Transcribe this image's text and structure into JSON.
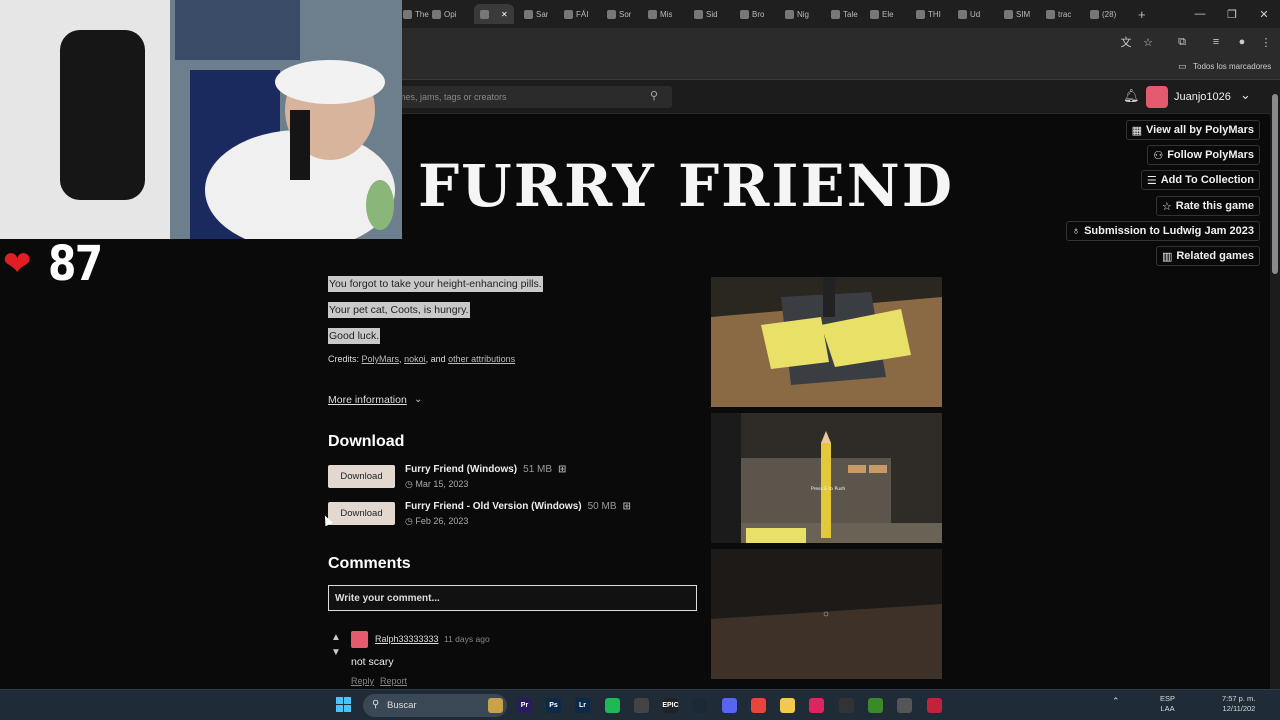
{
  "browser": {
    "tabs": [
      {
        "label": "The"
      },
      {
        "label": "Opi"
      },
      {
        "label": "",
        "active": true
      },
      {
        "label": "Sar"
      },
      {
        "label": "FÁI"
      },
      {
        "label": "Sor"
      },
      {
        "label": "Mis"
      },
      {
        "label": "Sid"
      },
      {
        "label": "Bro"
      },
      {
        "label": "Nig"
      },
      {
        "label": "Tale"
      },
      {
        "label": "Ele"
      },
      {
        "label": "THI"
      },
      {
        "label": "Ud"
      },
      {
        "label": "SIM"
      },
      {
        "label": "trac"
      },
      {
        "label": "(28)"
      }
    ],
    "bookmarks_folder": "Todos los marcadores"
  },
  "itch_header": {
    "search_placeholder": "Search for games, jams, tags or creators",
    "search_visible": "mes, jams, tags or creators",
    "username": "Juanjo1026"
  },
  "game": {
    "title": "FURRY FRIEND",
    "side_buttons": [
      {
        "label": "View all by PolyMars",
        "icon": "itch-icon"
      },
      {
        "label": "Follow PolyMars",
        "icon": "follow-user-icon"
      },
      {
        "label": "Add To Collection",
        "icon": "add-list-icon"
      },
      {
        "label": "Rate this game",
        "icon": "star-icon"
      },
      {
        "label": "Submission to Ludwig Jam 2023",
        "icon": "award-icon"
      },
      {
        "label": "Related games",
        "icon": "map-icon"
      }
    ],
    "description": [
      "You forgot to take your height-enhancing pills.",
      "Your pet cat, Coots, is hungry.",
      "Good luck."
    ],
    "credits_prefix": "Credits:",
    "credits": [
      "PolyMars",
      "nokoi",
      "other attributions"
    ],
    "credits_and": ", and",
    "more_info": "More information"
  },
  "download": {
    "heading": "Download",
    "files": [
      {
        "button": "Download",
        "name": "Furry Friend (Windows)",
        "size": "51 MB",
        "date": "Mar 15, 2023"
      },
      {
        "button": "Download",
        "name": "Furry Friend - Old Version (Windows)",
        "size": "50 MB",
        "date": "Feb 26, 2023"
      }
    ]
  },
  "comments": {
    "heading": "Comments",
    "placeholder": "Write your comment...",
    "items": [
      {
        "user": "Ralph33333333",
        "time": "11 days ago",
        "text": "not scary",
        "reply": "Reply",
        "report": "Report"
      }
    ]
  },
  "stream_overlay": {
    "heart_count": "87"
  },
  "screenshot_texts": {
    "press_to_push": "Press E to Push"
  },
  "taskbar": {
    "search": "Buscar",
    "lang_top": "ESP",
    "lang_bottom": "LAA",
    "time": "7:57 p. m.",
    "date": "12/11/202"
  },
  "colors": {
    "page_bg": "#0a0a0a",
    "accent_pink": "#e45a6e",
    "download_btn": "#e2d8d0",
    "heart": "#e01f24"
  }
}
